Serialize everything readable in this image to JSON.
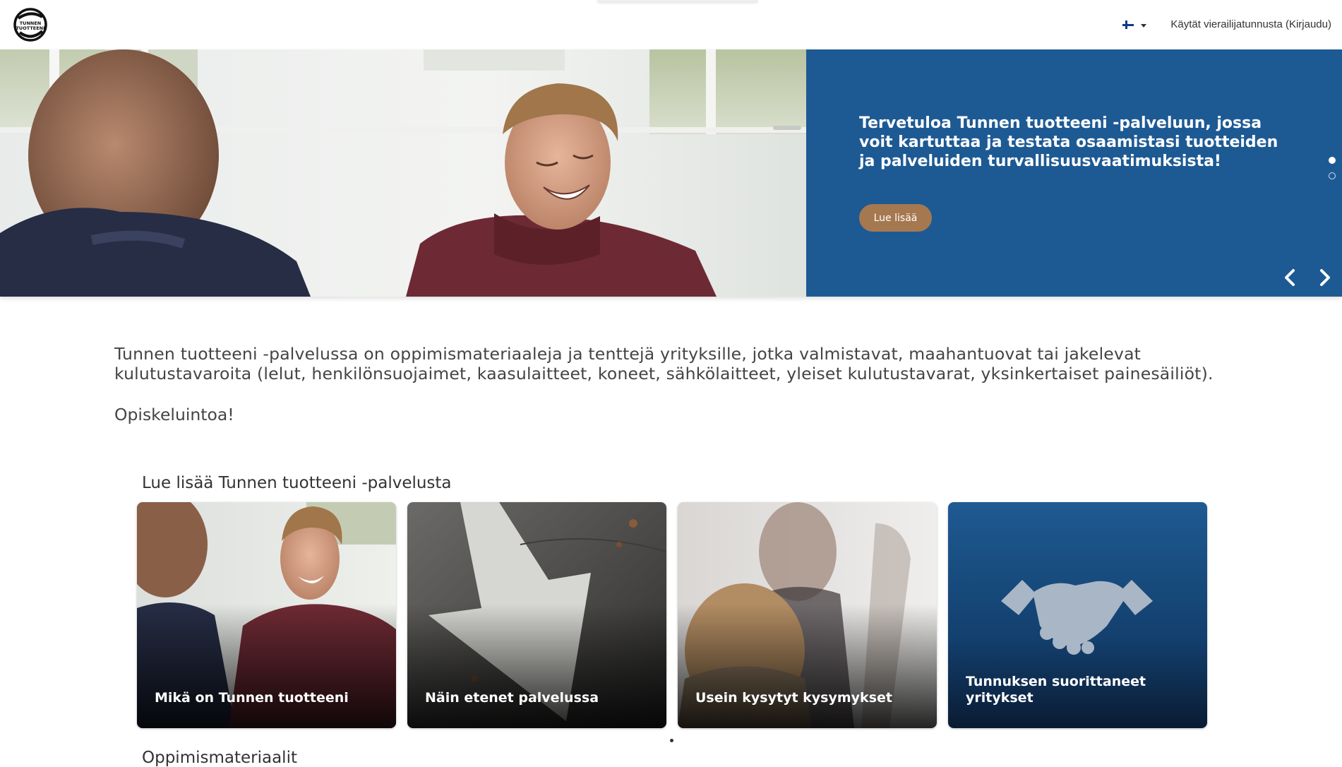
{
  "header": {
    "logo_text": "TUNNEN TUOTTEENI",
    "guest_link": "Käytät vierailijatunnusta (Kirjaudu)"
  },
  "hero": {
    "heading": "Tervetuloa Tunnen tuotteeni -palveluun, jossa voit kartuttaa ja testata osaamistasi tuotteiden ja palveluiden turvallisuusvaatimuksista!",
    "button_label": "Lue lisää",
    "panel_color": "#1d5a94",
    "button_color": "#a67850"
  },
  "intro": {
    "text": "Tunnen tuotteeni -palvelussa on oppimismateriaaleja ja tenttejä yrityksille, jotka valmistavat, maahantuovat tai jakelevat kulutustavaroita (lelut, henkilönsuojaimet, kaasulaitteet, koneet, sähkölaitteet, yleiset kulutustavarat, yksinkertaiset painesäiliöt).",
    "greeting": "Opiskeluintoa!"
  },
  "read_more": {
    "title": "Lue lisää Tunnen tuotteeni -palvelusta",
    "cards": [
      {
        "label": "Mikä on Tunnen tuotteeni"
      },
      {
        "label": "Näin etenet palvelussa"
      },
      {
        "label": "Usein kysytyt kysymykset"
      },
      {
        "label": "Tunnuksen suorittaneet yritykset"
      }
    ]
  },
  "learning_materials": {
    "title": "Oppimismateriaalit"
  }
}
